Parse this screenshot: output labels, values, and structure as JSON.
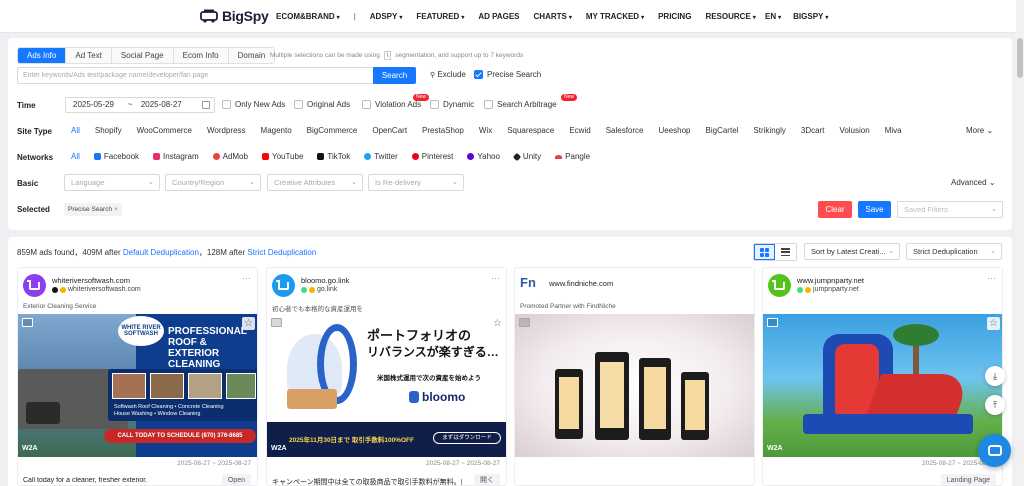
{
  "nav": {
    "logo": "BigSpy",
    "menu": [
      {
        "label": "ECOM&BRAND",
        "dropdown": true
      },
      {
        "label": "ADSPY",
        "dropdown": true
      },
      {
        "label": "FEATURED",
        "dropdown": true
      },
      {
        "label": "AD PAGES",
        "dropdown": false
      },
      {
        "label": "CHARTS",
        "dropdown": true
      },
      {
        "label": "MY TRACKED",
        "dropdown": true
      },
      {
        "label": "PRICING",
        "dropdown": false
      },
      {
        "label": "RESOURCE",
        "dropdown": true
      }
    ],
    "separator": "|",
    "language": "EN",
    "account": "BIGSPY"
  },
  "filters": {
    "tabs": [
      "Ads Info",
      "Ad Text",
      "Social Page",
      "Ecom Info",
      "Domain"
    ],
    "active_tab": 0,
    "hint_before": "Multiple selections can be made using",
    "hint_key": "\\",
    "hint_after": "segmentation, and support up to 7 keywords",
    "search_placeholder": "Enter keywords/Ads text/package name/developer/fan page",
    "search_button": "Search",
    "exclude_label": "Exclude",
    "precise_label": "Precise Search",
    "time_label": "Time",
    "date_start": "2025-05-29",
    "date_end": "2025-08-27",
    "time_options": [
      {
        "label": "Only New Ads",
        "new": false
      },
      {
        "label": "Original Ads",
        "new": false
      },
      {
        "label": "Violation Ads",
        "new": true
      },
      {
        "label": "Dynamic",
        "new": false
      },
      {
        "label": "Search Arbitrage",
        "new": true
      }
    ],
    "new_badge": "New",
    "site_type_label": "Site Type",
    "site_types": [
      "All",
      "Shopify",
      "WooCommerce",
      "Wordpress",
      "Magento",
      "BigCommerce",
      "OpenCart",
      "PrestaShop",
      "Wix",
      "Squarespace",
      "Ecwid",
      "Salesforce",
      "Ueeshop",
      "BigCartel",
      "Strikingly",
      "3Dcart",
      "Volusion",
      "Miva"
    ],
    "more_label": "More",
    "networks_label": "Networks",
    "networks": [
      {
        "name": "All",
        "color": ""
      },
      {
        "name": "Facebook",
        "color": "#1877f2"
      },
      {
        "name": "Instagram",
        "color": "#e1306c"
      },
      {
        "name": "AdMob",
        "color": "#ea4335"
      },
      {
        "name": "YouTube",
        "color": "#ff0000"
      },
      {
        "name": "TikTok",
        "color": "#111111"
      },
      {
        "name": "Twitter",
        "color": "#1da1f2"
      },
      {
        "name": "Pinterest",
        "color": "#e60023"
      },
      {
        "name": "Yahoo",
        "color": "#6001d2"
      },
      {
        "name": "Unity",
        "color": "#222222"
      },
      {
        "name": "Pangle",
        "color": "#f04142"
      }
    ],
    "basic_label": "Basic",
    "basic_selects": [
      "Language",
      "Country/Region",
      "Creative Attributes",
      "Is Re-delivery"
    ],
    "advanced_label": "Advanced",
    "selected_label": "Selected",
    "selected_chip": "Precise Search",
    "clear_button": "Clear",
    "save_button": "Save",
    "saved_filters_placeholder": "Saved Filters"
  },
  "results": {
    "count_prefix": "859M ads found，409M after",
    "default_dedup": "Default Deduplication",
    "count_mid": "，128M after",
    "strict_dedup": "Strict Deduplication",
    "sort_label": "Sort by Latest Creati...",
    "dedup_label": "Strict Deduplication"
  },
  "cards": [
    {
      "name": "whiteriversoftwash.com",
      "sub": "whiteriversoftwash.com",
      "tag": "Exterior Cleaning Service",
      "date": "2025-08-27 ~ 2025-08-27",
      "text": "Call today for a cleaner, fresher exterior.",
      "cta": "Open",
      "badge": "W2A",
      "avatar_color": "#8b3df0",
      "ad": {
        "headline": "PROFESSIONAL ROOF & EXTERIOR CLEANING",
        "bullets": [
          "Softwash Roof Cleaning",
          "Concrete Cleaning",
          "House Washing",
          "Window Cleaning"
        ],
        "phone": "CALL TODAY TO SCHEDULE  (870) 376-8685"
      }
    },
    {
      "name": "bloomo.go.link",
      "sub": "go.link",
      "tag": "初心者でも本格的な資産運用を",
      "date": "2025-08-27 ~ 2025-08-27",
      "text": "キャンペーン期間中は全ての取扱商品で取引手数料が無料。口座開",
      "cta": "開く",
      "badge": "W2A",
      "avatar_color": "#1a9bf0",
      "ad": {
        "headline1": "ポートフォリオの",
        "headline2": "リバランスが楽すぎる…",
        "sub": "米国株式運用で次の資産を始めよう",
        "brand": "bloomo",
        "footer": "2025年11月30日まで 取引手数料100%OFF",
        "footer_btn": "まずはダウンロード"
      }
    },
    {
      "name": "www.findniche.com",
      "sub": "",
      "tag": "Promoted Partner with FindNiche",
      "date": "",
      "text": "",
      "cta": "",
      "badge": "",
      "avatar_color": ""
    },
    {
      "name": "www.jumpnparty.net",
      "sub": "jumpnparty.net",
      "tag": "",
      "date": "2025-08-27 ~ 2025-08-27",
      "text": "",
      "cta": "Landing Page",
      "badge": "W2A",
      "avatar_color": "#52c41a"
    }
  ],
  "colors": {
    "primary": "#1677ff",
    "danger": "#ff4d4f"
  }
}
